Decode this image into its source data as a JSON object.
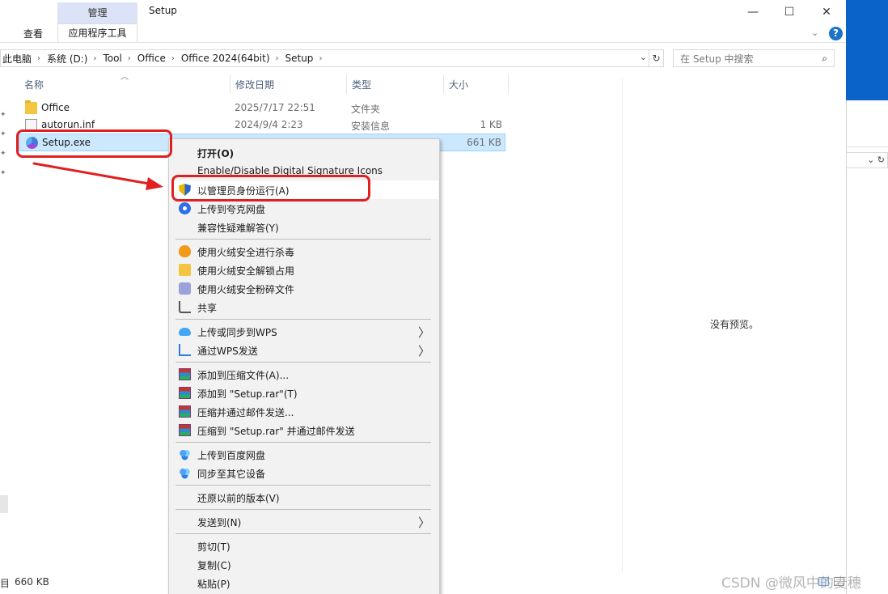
{
  "window": {
    "title": "Setup",
    "minimize_glyph": "—",
    "maximize_glyph": "☐",
    "close_glyph": "✕",
    "expand_glyph": "⌄",
    "help_glyph": "?"
  },
  "ribbon": {
    "tab_manage": "管理",
    "tab_view": "查看",
    "tab_tools": "应用程序工具"
  },
  "address": {
    "crumbs": [
      "此电脑",
      "系统 (D:)",
      "Tool",
      "Office",
      "Office 2024(64bit)",
      "Setup"
    ],
    "dropdown_glyph": "⌄",
    "refresh_glyph": "↻",
    "search_placeholder": "在 Setup 中搜索",
    "search_glyph": "⌕"
  },
  "columns": {
    "name": "名称",
    "modified": "修改日期",
    "type": "类型",
    "size": "大小"
  },
  "files": [
    {
      "name": "Office",
      "modified": "2025/7/17 22:51",
      "type": "文件夹",
      "size": "",
      "icon": "folder-icon"
    },
    {
      "name": "autorun.inf",
      "modified": "2024/9/4 2:23",
      "type": "安装信息",
      "size": "1 KB",
      "icon": "inf-file-icon"
    },
    {
      "name": "Setup.exe",
      "modified": "",
      "type": "",
      "size": "661 KB",
      "icon": "exe-icon"
    }
  ],
  "context_menu": {
    "items": [
      {
        "label": "打开(O)",
        "icon": ""
      },
      {
        "label": "Enable/Disable Digital Signature Icons",
        "icon": ""
      },
      {
        "label": "以管理员身份运行(A)",
        "icon": "uac-shield-icon"
      },
      {
        "label": "上传到夸克网盘",
        "icon": "quark-icon"
      },
      {
        "label": "兼容性疑难解答(Y)",
        "icon": ""
      },
      {
        "label": "使用火绒安全进行杀毒",
        "icon": "huorong-icon"
      },
      {
        "label": "使用火绒安全解锁占用",
        "icon": "folder-lock-icon"
      },
      {
        "label": "使用火绒安全粉碎文件",
        "icon": "shredder-icon"
      },
      {
        "label": "共享",
        "icon": "share-icon"
      },
      {
        "label": "上传或同步到WPS",
        "icon": "wps-cloud-icon"
      },
      {
        "label": "通过WPS发送",
        "icon": "wps-send-icon"
      },
      {
        "label": "添加到压缩文件(A)...",
        "icon": "winrar-icon"
      },
      {
        "label": "添加到 \"Setup.rar\"(T)",
        "icon": "winrar-icon"
      },
      {
        "label": "压缩并通过邮件发送...",
        "icon": "winrar-icon"
      },
      {
        "label": "压缩到 \"Setup.rar\" 并通过邮件发送",
        "icon": "winrar-icon"
      },
      {
        "label": "上传到百度网盘",
        "icon": "baidu-icon"
      },
      {
        "label": "同步至其它设备",
        "icon": "baidu-icon"
      },
      {
        "label": "还原以前的版本(V)",
        "icon": ""
      },
      {
        "label": "发送到(N)",
        "icon": ""
      },
      {
        "label": "剪切(T)",
        "icon": ""
      },
      {
        "label": "复制(C)",
        "icon": ""
      },
      {
        "label": "粘贴(P)",
        "icon": ""
      }
    ],
    "submenu_glyph": "〉"
  },
  "preview": {
    "message": "没有预览。"
  },
  "status": {
    "prefix": "目",
    "selected_size": "660 KB"
  },
  "watermark": "CSDN @微风中的麦穗",
  "annotation_color": "#e02020"
}
